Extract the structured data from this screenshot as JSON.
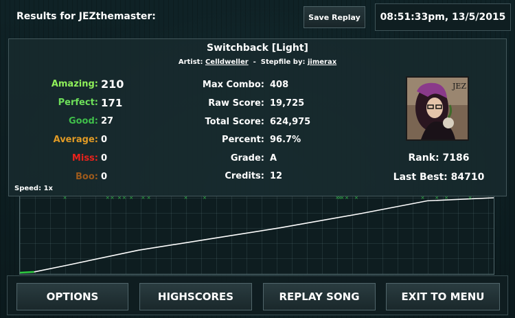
{
  "header": {
    "title": "Results for JEZthemaster:",
    "save_replay_label": "Save Replay",
    "datetime": "08:51:33pm, 13/5/2015"
  },
  "song": {
    "title": "Switchback [Light]",
    "artist_label": "Artist:",
    "artist": "Celldweller",
    "separator": "-",
    "stepfile_label": "Stepfile by:",
    "stepfile_by": "jimerax"
  },
  "judgements": [
    {
      "label": "Amazing:",
      "value": "210",
      "color": "#8ff05a"
    },
    {
      "label": "Perfect:",
      "value": "171",
      "color": "#6ee05a"
    },
    {
      "label": "Good:",
      "value": "27",
      "color": "#3fbf4a"
    },
    {
      "label": "Average:",
      "value": "0",
      "color": "#e09a25"
    },
    {
      "label": "Miss:",
      "value": "0",
      "color": "#e8221c"
    },
    {
      "label": "Boo:",
      "value": "0",
      "color": "#9c5a1c"
    }
  ],
  "stats": [
    {
      "label": "Max Combo:",
      "value": "408"
    },
    {
      "label": "Raw Score:",
      "value": "19,725"
    },
    {
      "label": "Total Score:",
      "value": "624,975"
    },
    {
      "label": "Percent:",
      "value": "96.7%"
    },
    {
      "label": "Grade:",
      "value": "A"
    },
    {
      "label": "Credits:",
      "value": "12"
    }
  ],
  "player": {
    "avatar_text": "JEZ",
    "rank_label": "Rank:",
    "rank": "7186",
    "last_best_label": "Last Best:",
    "last_best": "84710"
  },
  "speed_label": "Speed: 1x",
  "graph": {
    "progress_points": [
      [
        0,
        0
      ],
      [
        0.03,
        0.01
      ],
      [
        0.1,
        0.1
      ],
      [
        0.25,
        0.3
      ],
      [
        0.4,
        0.45
      ],
      [
        0.55,
        0.6
      ],
      [
        0.72,
        0.79
      ],
      [
        0.86,
        0.96
      ],
      [
        1,
        1
      ]
    ],
    "miss_marker_positions": [
      0.095,
      0.185,
      0.195,
      0.21,
      0.22,
      0.235,
      0.26,
      0.272,
      0.35,
      0.39,
      0.67,
      0.675,
      0.68,
      0.69,
      0.71,
      0.85,
      0.88,
      0.9,
      0.95
    ],
    "line_color": "#ffffff",
    "start_color": "#2ecc40",
    "marker_color": "#34c04a"
  },
  "buttons": {
    "options": "OPTIONS",
    "highscores": "HIGHSCORES",
    "replay_song": "REPLAY SONG",
    "exit_to_menu": "EXIT TO MENU"
  }
}
